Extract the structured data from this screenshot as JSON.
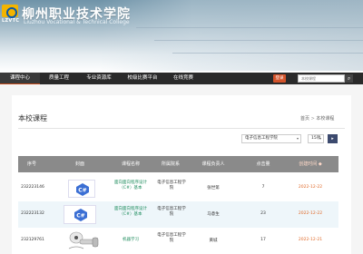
{
  "header": {
    "school_cn": "柳州职业技术学院",
    "school_en": "Liuzhou Vocational & Technical College",
    "logo_text": "LZVTC"
  },
  "nav": {
    "items": [
      "课程中心",
      "质量工程",
      "专业资源库",
      "校级比赛平台",
      "在线竞赛"
    ],
    "active_index": 0,
    "login_label": "登录",
    "search_placeholder": "本校课程"
  },
  "main": {
    "title": "本校课程",
    "breadcrumb": [
      "首页",
      "本校课程"
    ],
    "dept_select": "电子信息工程学院",
    "per_page_select": "15项",
    "go_label": "▸"
  },
  "table": {
    "headers": [
      "序号",
      "封面",
      "课程名称",
      "所属院系",
      "课程负责人",
      "点击量",
      "创建时间"
    ],
    "sortable_header": "创建时间",
    "rows": [
      {
        "id": "232223146",
        "cover": "csharp",
        "name": "面向面向程序设计（C#）基本",
        "dept": "电子信息工程学院",
        "person": "张世第",
        "count": "7",
        "date": "2022-12-22"
      },
      {
        "id": "232223132",
        "cover": "csharp",
        "name": "面向面向程序设计（C#）基本",
        "dept": "电子信息工程学院",
        "person": "马意生",
        "count": "23",
        "date": "2022-12-22"
      },
      {
        "id": "232129761",
        "cover": "robot",
        "name": "机器学习",
        "dept": "电子信息工程学院",
        "person": "黄城",
        "count": "17",
        "date": "2022-12-21"
      }
    ]
  },
  "colors": {
    "nav_bg": "#2a2a2a",
    "accent": "#d4532a",
    "link_green": "#1a8a5a",
    "date_orange": "#e06a2a",
    "table_header": "#8a8a8a"
  }
}
